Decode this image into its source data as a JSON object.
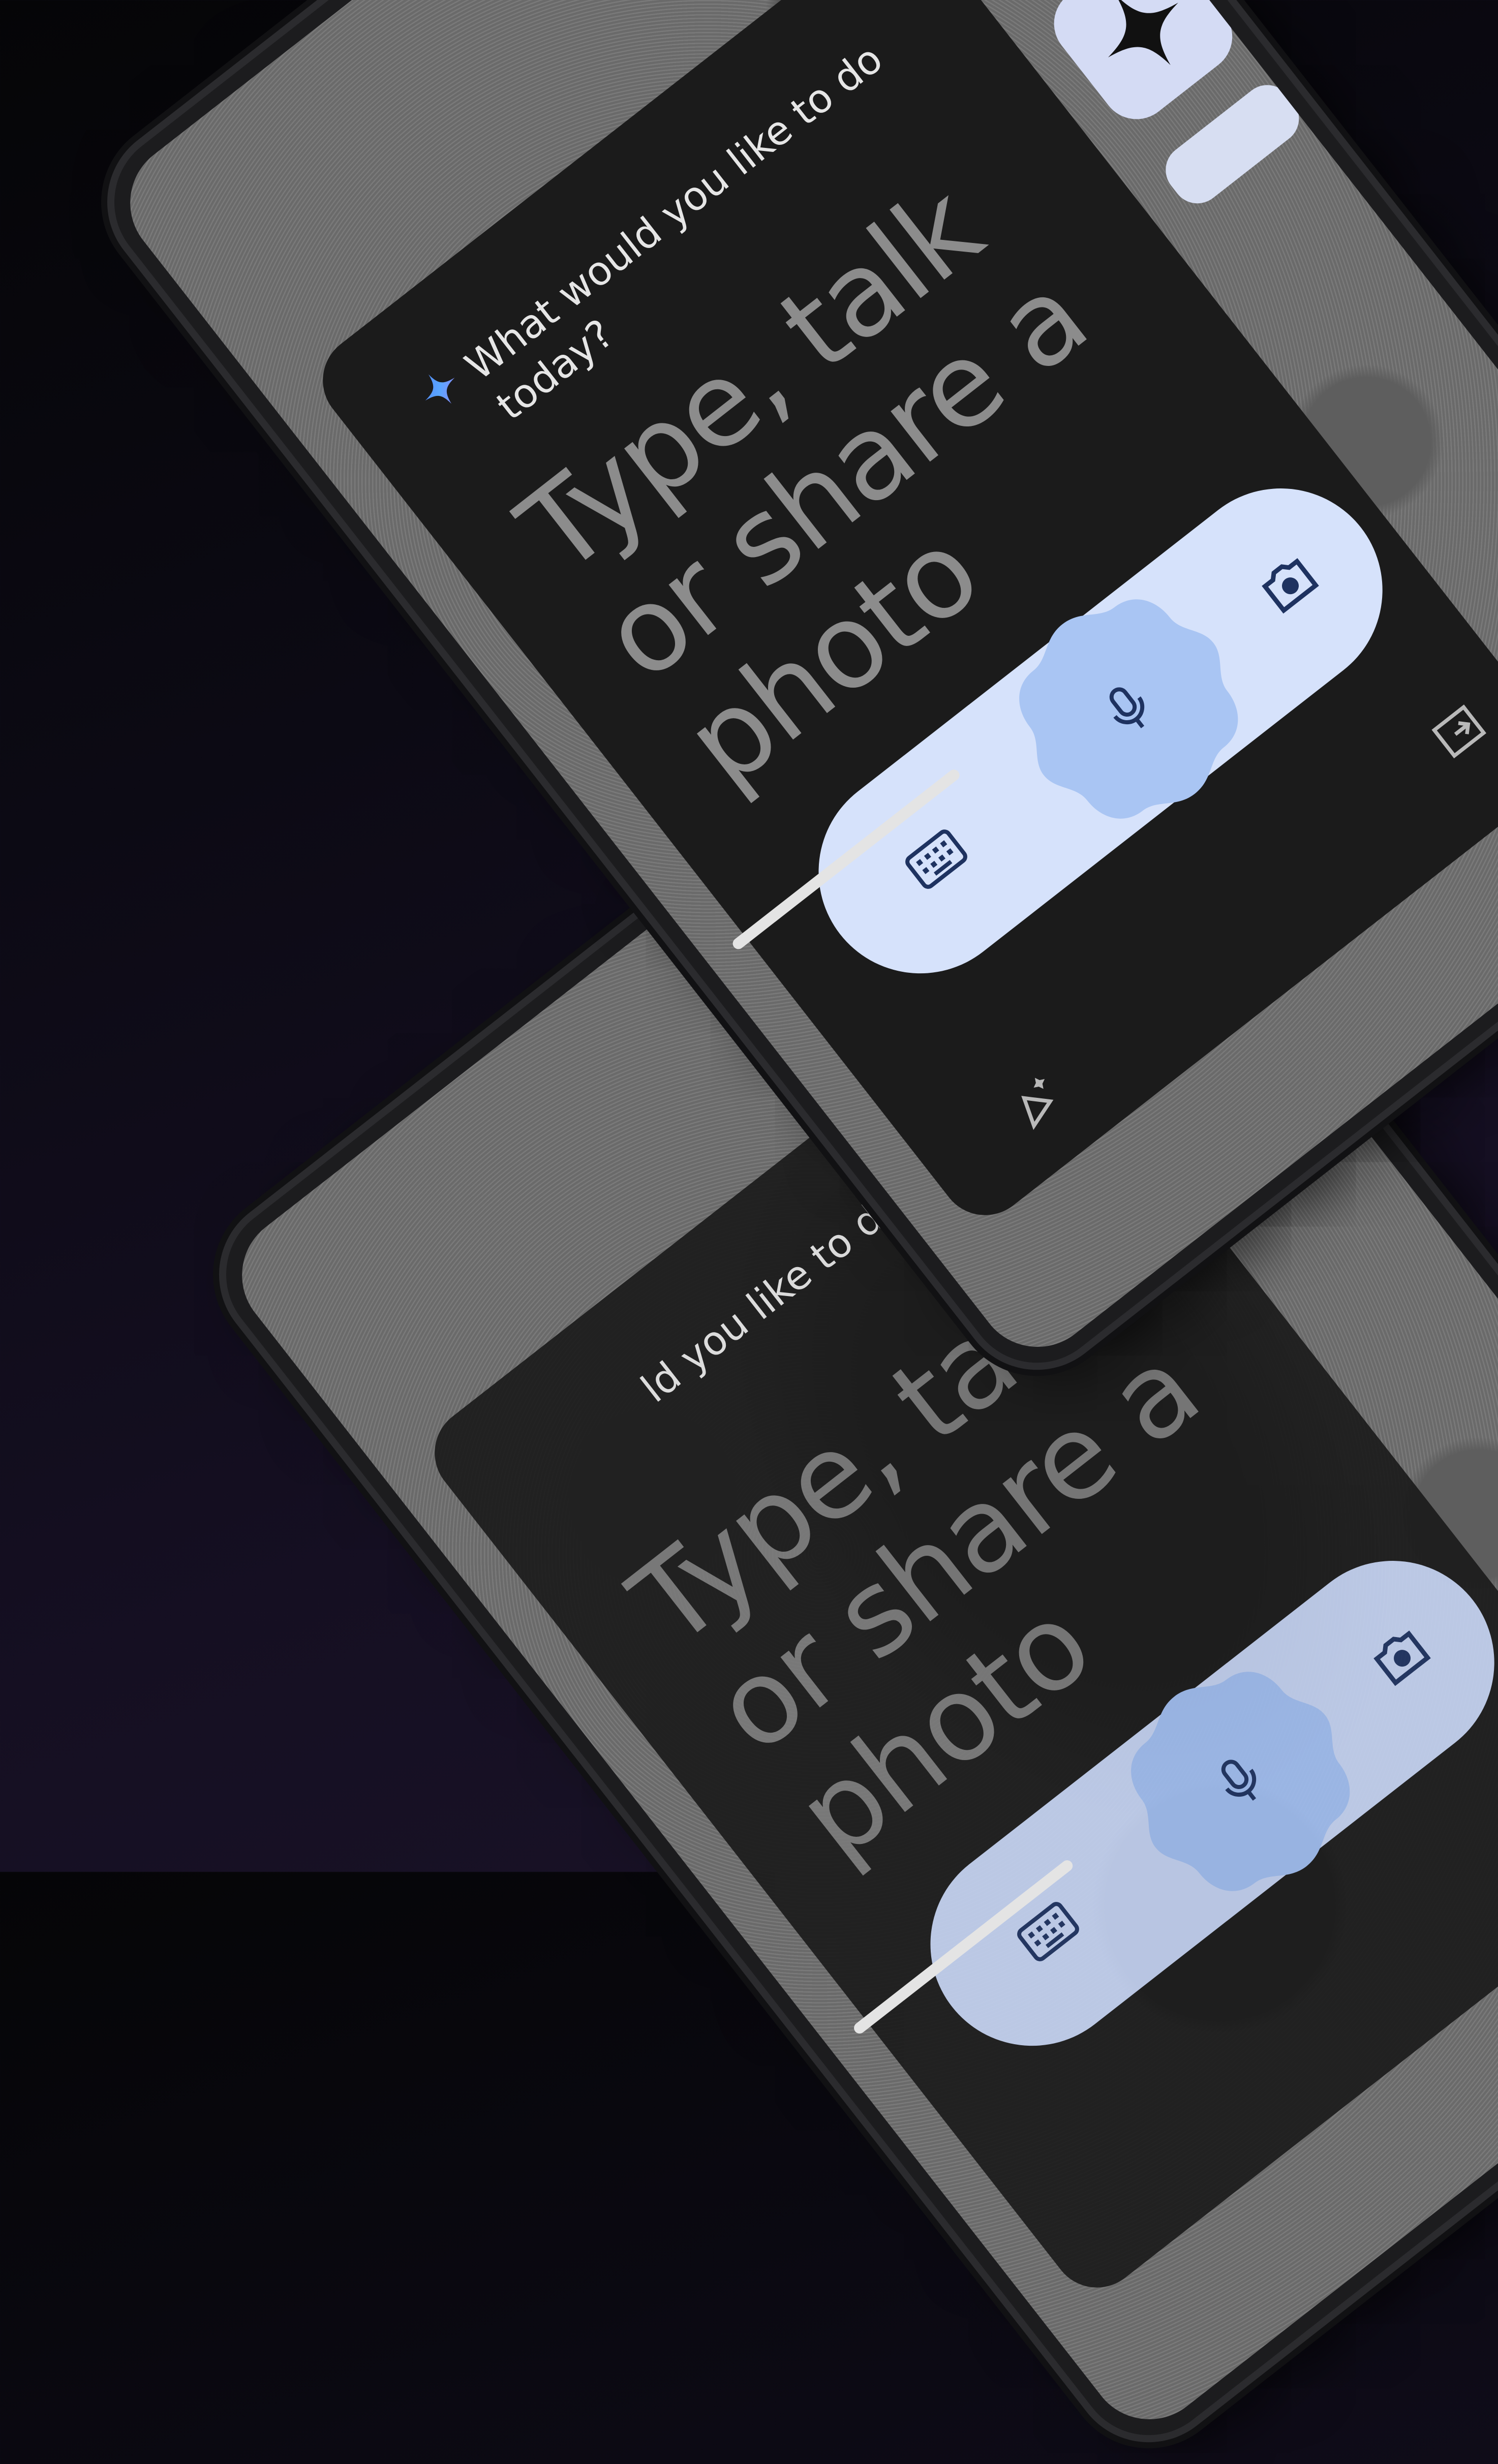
{
  "assistant": {
    "question": "What would you like to do today?",
    "prompt": "Type, talk or share a photo"
  },
  "phone_b": {
    "question_partial": "ld you like to do",
    "prompt": "Type, talk or share a photo"
  },
  "actions": [
    {
      "id": "keyboard",
      "icon": "keyboard-icon"
    },
    {
      "id": "voice",
      "icon": "mic-icon"
    },
    {
      "id": "camera",
      "icon": "camera-icon"
    }
  ],
  "apps": [
    {
      "id": "reddit",
      "icon": "reddit-icon"
    },
    {
      "id": "spotify",
      "icon": "spotify-icon"
    },
    {
      "id": "gemini",
      "icon": "sparkle-icon"
    }
  ],
  "colors": {
    "overlay_bg": "#1b1b1b",
    "pill_bg": "#d6e2fb",
    "mic_blob": "#a9c5f3",
    "app_icon_bg": "#d4dbf4",
    "sun": "#f4c13f"
  }
}
